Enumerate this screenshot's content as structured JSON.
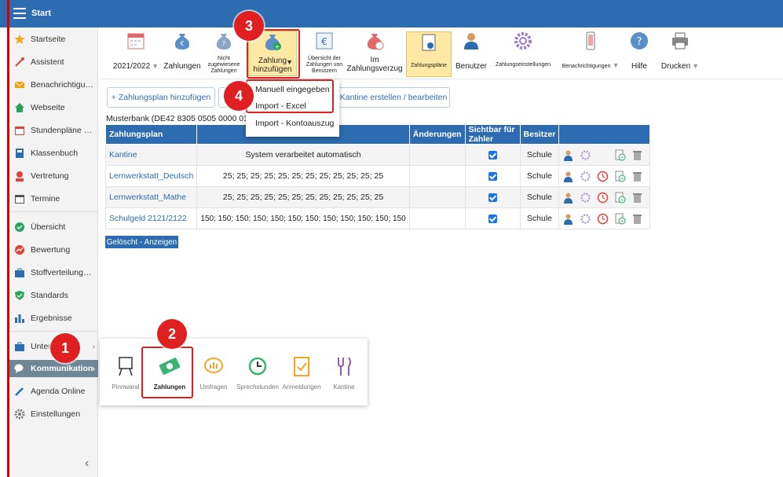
{
  "topbar": {
    "title": "Start"
  },
  "sidebar": {
    "items": [
      {
        "label": "Startseite",
        "icon": "star-icon"
      },
      {
        "label": "Assistent",
        "icon": "wand-icon"
      },
      {
        "label": "Benachrichtigungen",
        "icon": "envelope-icon"
      },
      {
        "label": "Webseite",
        "icon": "home-icon"
      },
      {
        "label": "Stundenpläne und Räume",
        "icon": "calendar-icon"
      },
      {
        "label": "Klassenbuch",
        "icon": "book-icon"
      },
      {
        "label": "Vertretung",
        "icon": "person-icon"
      },
      {
        "label": "Termine",
        "icon": "calendar-icon"
      },
      {
        "label": "Übersicht",
        "icon": "check-circle-icon"
      },
      {
        "label": "Bewertung",
        "icon": "chart-circle-icon"
      },
      {
        "label": "Stoffverteilungspläne",
        "icon": "briefcase-icon"
      },
      {
        "label": "Standards",
        "icon": "shield-check-icon"
      },
      {
        "label": "Ergebnisse",
        "icon": "bar-chart-icon"
      },
      {
        "label": "Unterricht",
        "icon": "briefcase-icon"
      },
      {
        "label": "Kommunikation",
        "icon": "chat-icon"
      },
      {
        "label": "Agenda Online",
        "icon": "pen-icon"
      },
      {
        "label": "Einstellungen",
        "icon": "gear-icon"
      }
    ]
  },
  "toolbar": {
    "year": "2021/2022",
    "zahlungen": "Zahlungen",
    "nicht_zugewiesen": "Nicht zugewiesene Zahlungen",
    "zahlung_hinzufuegen": "Zahlung hinzufügen",
    "uebersicht": "Übersicht der Zahlungen von Benutzern",
    "verzug": "Im Zahlungsverzug",
    "zahlungsplaene": "Zahlungspläne",
    "benutzer": "Benutzer",
    "zahlungseinstellungen": "Zahlungseinstellungen",
    "benachrichtigungen": "Benachrichtigungen",
    "hilfe": "Hilfe",
    "drucken": "Drucken"
  },
  "actions": {
    "add_plan": "+ Zahlungsplan hinzufügen",
    "kantine": "ul Kantine erstellen / bearbeiten",
    "deleted": "Gelöscht - Anzeigen"
  },
  "bank": "Musterbank (DE42 8305 0505 0000 0123",
  "table": {
    "headers": [
      "Zahlungsplan",
      "",
      "Änderungen",
      "Sichtbar für Zahler",
      "Besitzer",
      ""
    ],
    "rows": [
      {
        "name": "Kantine",
        "amounts": "System verarbeitet automatisch",
        "visible": true,
        "owner": "Schule"
      },
      {
        "name": "Lernwerkstatt_Deutsch",
        "amounts": "25; 25; 25; 25; 25; 25; 25; 25; 25; 25; 25; 25",
        "visible": true,
        "owner": "Schule"
      },
      {
        "name": "Lernwerkstatt_Mathe",
        "amounts": "25; 25; 25; 25; 25; 25; 25; 25; 25; 25; 25; 25",
        "visible": true,
        "owner": "Schule"
      },
      {
        "name": "Schulgeld 2121/2122",
        "amounts": "150; 150; 150; 150; 150; 150; 150; 150; 150; 150; 150; 150",
        "visible": true,
        "owner": "Schule"
      }
    ]
  },
  "dropdown": {
    "items": [
      "Manuell eingegeben",
      "Import - Excel",
      "Import - Kontoauszug"
    ]
  },
  "popup": {
    "items": [
      "Pinnwand",
      "Zahlungen",
      "Umfragen",
      "Sprechstunden",
      "Anmeldungen",
      "Kantine"
    ]
  },
  "badges": [
    "1",
    "2",
    "3",
    "4"
  ],
  "colors": {
    "primary": "#2d6cb0",
    "annotation": "#e02020",
    "highlight": "#fde9a4"
  }
}
